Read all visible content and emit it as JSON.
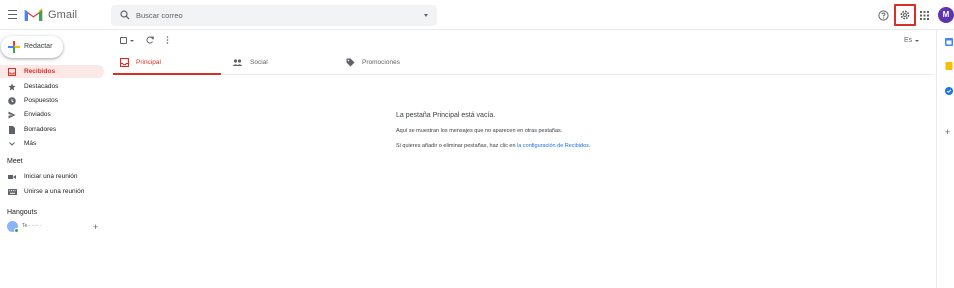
{
  "header": {
    "logo_text": "Gmail",
    "search_placeholder": "Buscar correo",
    "avatar_initial": "M"
  },
  "sidebar": {
    "compose_label": "Redactar",
    "items": [
      {
        "label": "Recibidos",
        "icon": "inbox-icon",
        "active": true
      },
      {
        "label": "Destacados",
        "icon": "star-icon"
      },
      {
        "label": "Pospuestos",
        "icon": "clock-icon"
      },
      {
        "label": "Enviados",
        "icon": "send-icon"
      },
      {
        "label": "Borradores",
        "icon": "file-icon"
      },
      {
        "label": "Más",
        "icon": "chevron-down-icon"
      }
    ],
    "meet": {
      "title": "Meet",
      "items": [
        {
          "label": "Iniciar una reunión",
          "icon": "video-icon"
        },
        {
          "label": "Unirse a una reunión",
          "icon": "keyboard-icon"
        }
      ]
    },
    "hangouts": {
      "title": "Hangouts",
      "user_name": "Te·· ···· ·"
    }
  },
  "toolbar": {
    "language": "Es"
  },
  "tabs": [
    {
      "label": "Principal",
      "active": true
    },
    {
      "label": "Social"
    },
    {
      "label": "Promociones"
    }
  ],
  "empty_state": {
    "title": "La pestaña Principal está vacía.",
    "line1": "Aquí se muestran los mensajes que no aparecen en otras pestañas.",
    "line2_prefix": "Si quieres añadir o eliminar pestañas, haz clic en ",
    "line2_link": "la configuración de Recibidos",
    "line2_suffix": "."
  },
  "colors": {
    "accent_red": "#d93025",
    "link_blue": "#1a73e8",
    "avatar_purple": "#5e35b1"
  }
}
